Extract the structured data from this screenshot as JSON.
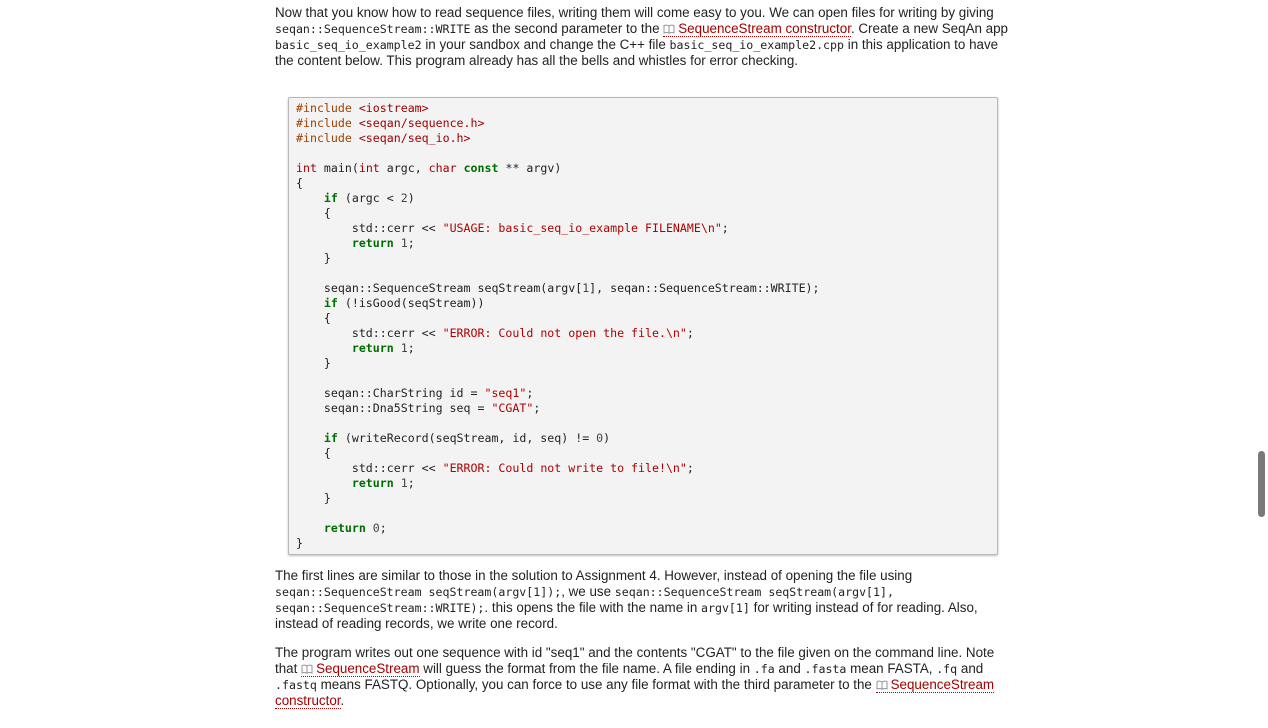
{
  "para1": {
    "t1": "Now that you know how to read sequence files, writing them will come easy to you. We can open files for writing by giving ",
    "c1": "seqan::SequenceStream::WRITE",
    "t2": " as the second parameter to the ",
    "link1": "SequenceStream constructor",
    "t3": ". Create a new SeqAn app ",
    "c2": "basic_seq_io_example2",
    "t4": " in your sandbox and change the C++ file ",
    "c3": "basic_seq_io_example2.cpp",
    "t5": " in this application to have the content below. This program already has all the bells and whistles for error checking."
  },
  "code_lines": [
    "#include <iostream>",
    "#include <seqan/sequence.h>",
    "#include <seqan/seq_io.h>",
    "",
    "int main(int argc, char const ** argv)",
    "{",
    "    if (argc < 2)",
    "    {",
    "        std::cerr << \"USAGE: basic_seq_io_example FILENAME\\n\";",
    "        return 1;",
    "    }",
    "",
    "    seqan::SequenceStream seqStream(argv[1], seqan::SequenceStream::WRITE);",
    "    if (!isGood(seqStream))",
    "    {",
    "        std::cerr << \"ERROR: Could not open the file.\\n\";",
    "        return 1;",
    "    }",
    "",
    "    seqan::CharString id = \"seq1\";",
    "    seqan::Dna5String seq = \"CGAT\";",
    "",
    "    if (writeRecord(seqStream, id, seq) != 0)",
    "    {",
    "        std::cerr << \"ERROR: Could not write to file!\\n\";",
    "        return 1;",
    "    }",
    "",
    "    return 0;",
    "}"
  ],
  "para2": {
    "t1": "The first lines are similar to those in the solution to Assignment 4. However, instead of opening the file using ",
    "c1": "seqan::SequenceStream seqStream(argv[1]);",
    "t2": ", we use ",
    "c2": "seqan::SequenceStream seqStream(argv[1], seqan::SequenceStream::WRITE);",
    "t3": ". this opens the file with the name in ",
    "c3": "argv[1]",
    "t4": " for writing instead of for reading. Also, instead of reading records, we write one record."
  },
  "para3": {
    "t1": "The program writes out one sequence with id \"seq1\" and the contents \"CGAT\" to the file given on the command line. Note that ",
    "link1": "SequenceStream",
    "t2": " will guess the format from the file name. A file ending in ",
    "c1": ".fa",
    "t3": " and ",
    "c2": ".fasta",
    "t4": " mean FASTA, ",
    "c3": ".fq",
    "t5": " and ",
    "c4": ".fastq",
    "t6": " means FASTQ. Optionally, you can force to use any file format with the third parameter to the ",
    "link2": "SequenceStream constructor",
    "t7": "."
  },
  "colors": {
    "link": "#a40000",
    "keyword": "#006d00",
    "string": "#b00000",
    "preprocessor": "#a04000"
  },
  "icons": [
    "book-icon"
  ]
}
